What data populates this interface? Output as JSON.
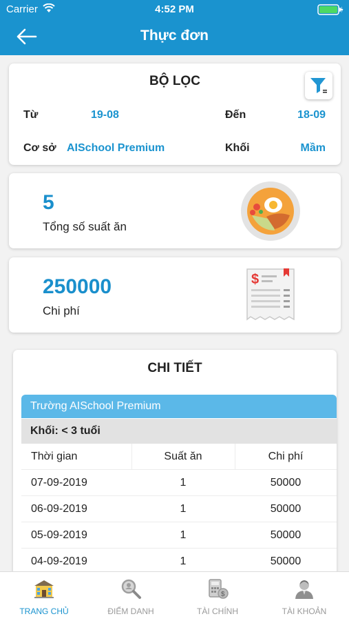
{
  "status_bar": {
    "carrier": "Carrier",
    "time": "4:52 PM"
  },
  "nav": {
    "title": "Thực đơn",
    "back_icon": "arrow-left-icon"
  },
  "filter": {
    "title": "BỘ LỌC",
    "icon": "filter-icon",
    "from_label": "Từ",
    "from_value": "19-08",
    "to_label": "Đến",
    "to_value": "18-09",
    "campus_label": "Cơ sở",
    "campus_value": "AISchool Premium",
    "grade_label": "Khối",
    "grade_value": "Mầm"
  },
  "meals": {
    "count": "5",
    "label": "Tổng số suất ăn",
    "icon": "food-plate-icon"
  },
  "cost": {
    "amount": "250000",
    "label": "Chi phí",
    "icon": "receipt-icon"
  },
  "detail": {
    "title": "CHI TIẾT",
    "school": "Trường AISchool Premium",
    "grade": "Khối: < 3 tuổi",
    "columns": [
      "Thời gian",
      "Suất ăn",
      "Chi phí"
    ],
    "rows": [
      [
        "07-09-2019",
        "1",
        "50000"
      ],
      [
        "06-09-2019",
        "1",
        "50000"
      ],
      [
        "05-09-2019",
        "1",
        "50000"
      ],
      [
        "04-09-2019",
        "1",
        "50000"
      ]
    ]
  },
  "tabs": [
    {
      "label": "TRANG CHỦ",
      "icon": "school-icon",
      "active": true
    },
    {
      "label": "ĐIỂM DANH",
      "icon": "magnifier-icon",
      "active": false
    },
    {
      "label": "TÀI CHÍNH",
      "icon": "calculator-icon",
      "active": false
    },
    {
      "label": "TÀI KHOẢN",
      "icon": "user-icon",
      "active": false
    }
  ],
  "colors": {
    "primary": "#1a93cf",
    "table_header": "#5bb8e8",
    "background": "#f2f2f2"
  }
}
